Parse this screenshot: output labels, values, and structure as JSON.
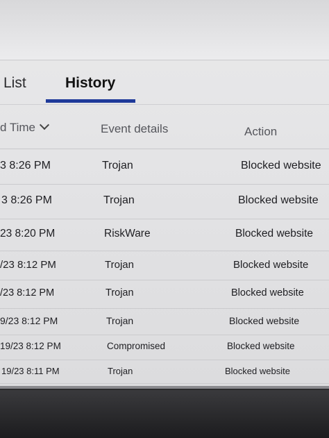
{
  "tabs": [
    {
      "label": "List"
    },
    {
      "label": "History"
    }
  ],
  "table": {
    "headers": {
      "time": "d Time",
      "event": "Event details",
      "action": "Action"
    },
    "rows": [
      {
        "time": "3 8:26 PM",
        "event": "Trojan",
        "action": "Blocked website"
      },
      {
        "time": "3 8:26 PM",
        "event": "Trojan",
        "action": "Blocked website"
      },
      {
        "time": "23 8:20 PM",
        "event": "RiskWare",
        "action": "Blocked website"
      },
      {
        "time": "/23 8:12 PM",
        "event": "Trojan",
        "action": "Blocked website"
      },
      {
        "time": "/23 8:12 PM",
        "event": "Trojan",
        "action": "Blocked website"
      },
      {
        "time": "9/23 8:12 PM",
        "event": "Trojan",
        "action": "Blocked website"
      },
      {
        "time": "19/23 8:12 PM",
        "event": "Compromised",
        "action": "Blocked website"
      },
      {
        "time": "19/23 8:11 PM",
        "event": "Trojan",
        "action": "Blocked website"
      }
    ]
  },
  "colors": {
    "tab_underline": "#1f3a9a"
  }
}
